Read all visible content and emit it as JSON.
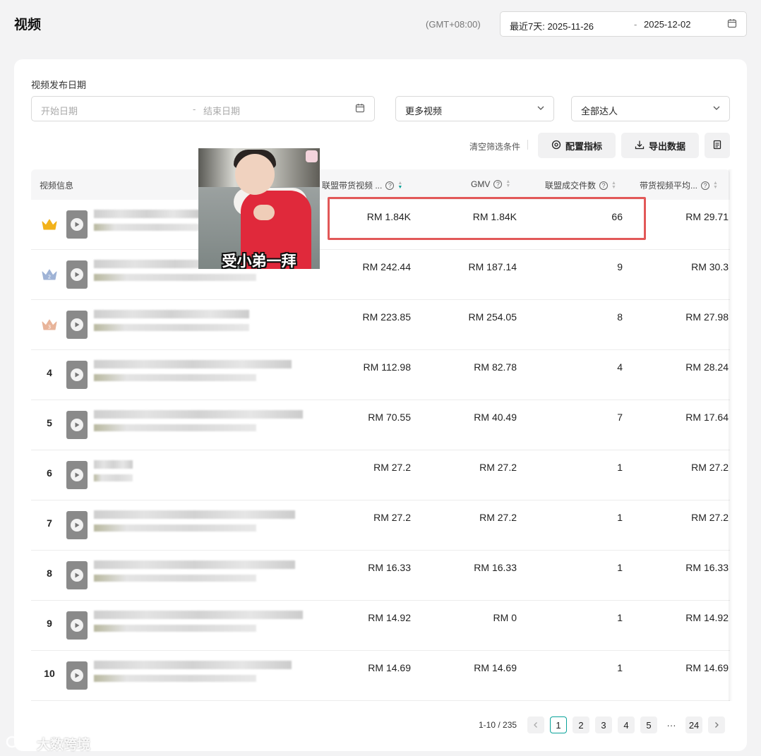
{
  "header": {
    "title": "视频",
    "timezone": "(GMT+08:00)",
    "date_range": {
      "start": "最近7天: 2025-11-26",
      "separator": "-",
      "end": "2025-12-02"
    }
  },
  "filters": {
    "publish_date_label": "视频发布日期",
    "start_placeholder": "开始日期",
    "separator": "-",
    "end_placeholder": "结束日期",
    "video_select": "更多视频",
    "creator_select": "全部达人",
    "clear_label": "清空筛选条件",
    "config_button": "配置指标",
    "export_button": "导出数据"
  },
  "table": {
    "columns": {
      "video_info": "视频信息",
      "affiliate_revenue": "联盟带货视频 ...",
      "gmv": "GMV",
      "affiliate_orders": "联盟成交件数",
      "avg": "带货视频平均..."
    },
    "rows": [
      {
        "rank": "1",
        "revenue": "RM 1.84K",
        "gmv": "RM 1.84K",
        "orders": "66",
        "avg": "RM 29.71"
      },
      {
        "rank": "2",
        "revenue": "RM 242.44",
        "gmv": "RM 187.14",
        "orders": "9",
        "avg": "RM 30.3"
      },
      {
        "rank": "3",
        "revenue": "RM 223.85",
        "gmv": "RM 254.05",
        "orders": "8",
        "avg": "RM 27.98"
      },
      {
        "rank": "4",
        "revenue": "RM 112.98",
        "gmv": "RM 82.78",
        "orders": "4",
        "avg": "RM 28.24"
      },
      {
        "rank": "5",
        "revenue": "RM 70.55",
        "gmv": "RM 40.49",
        "orders": "7",
        "avg": "RM 17.64"
      },
      {
        "rank": "6",
        "revenue": "RM 27.2",
        "gmv": "RM 27.2",
        "orders": "1",
        "avg": "RM 27.2"
      },
      {
        "rank": "7",
        "revenue": "RM 27.2",
        "gmv": "RM 27.2",
        "orders": "1",
        "avg": "RM 27.2"
      },
      {
        "rank": "8",
        "revenue": "RM 16.33",
        "gmv": "RM 16.33",
        "orders": "1",
        "avg": "RM 16.33"
      },
      {
        "rank": "9",
        "revenue": "RM 14.92",
        "gmv": "RM 0",
        "orders": "1",
        "avg": "RM 14.92"
      },
      {
        "rank": "10",
        "revenue": "RM 14.69",
        "gmv": "RM 14.69",
        "orders": "1",
        "avg": "RM 14.69"
      }
    ]
  },
  "overlay": {
    "meme_caption": "受小弟一拜"
  },
  "pagination": {
    "total": "1-10 / 235",
    "pages": [
      "1",
      "2",
      "3",
      "4",
      "5"
    ],
    "ellipsis": "···",
    "last": "24",
    "active": "1"
  },
  "watermark": "大数跨境",
  "colors": {
    "accent": "#0aa39a",
    "highlight": "#e25858",
    "gold_crown": "#f2b21b",
    "silver_crown": "#9fb3d6",
    "bronze_crown": "#e8b49a"
  },
  "icons": {
    "date": "calendar-icon",
    "select": "chevron-down-icon",
    "config": "gear-icon",
    "export": "download-icon",
    "doc": "document-icon",
    "play": "play-icon",
    "rank1": "crown-gold-icon",
    "rank2": "crown-silver-icon",
    "rank3": "crown-bronze-icon"
  }
}
